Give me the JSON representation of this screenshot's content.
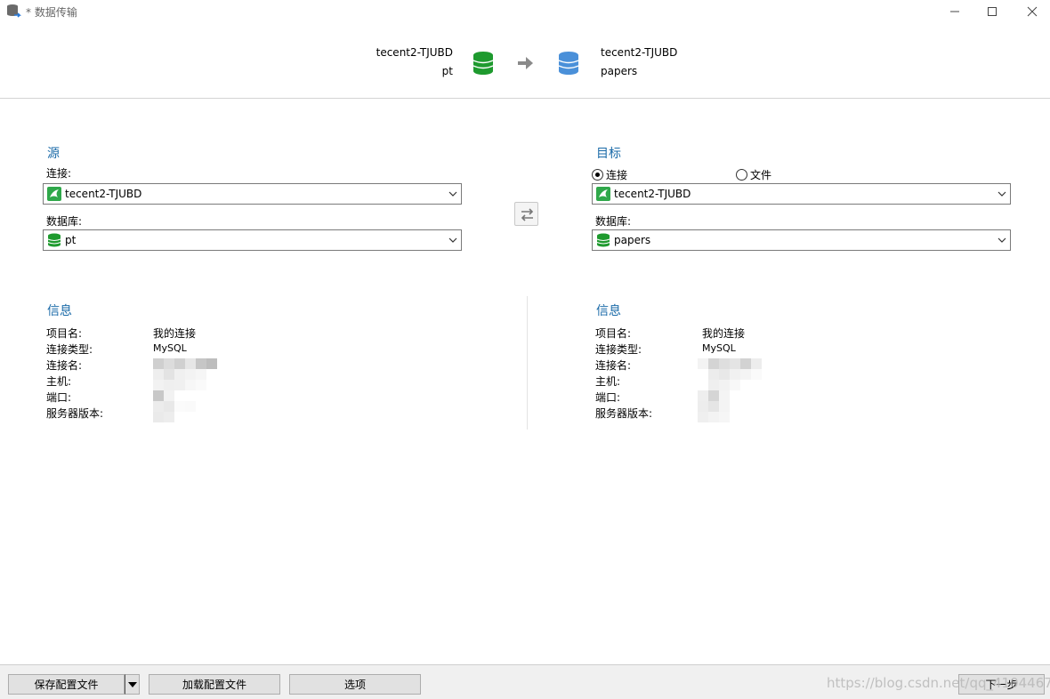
{
  "window": {
    "title": "* 数据传输",
    "minimize_glyph": "—",
    "maximize_glyph": "☐",
    "close_glyph": "✕"
  },
  "header": {
    "source_connection": "tecent2-TJUBD",
    "source_database": "pt",
    "target_connection": "tecent2-TJUBD",
    "target_database": "papers"
  },
  "source": {
    "title": "源",
    "connection_label": "连接:",
    "connection_value": "tecent2-TJUBD",
    "database_label": "数据库:",
    "database_value": "pt"
  },
  "target": {
    "title": "目标",
    "radio_connection": "连接",
    "radio_file": "文件",
    "radio_selected": "连接",
    "connection_value": "tecent2-TJUBD",
    "database_label": "数据库:",
    "database_value": "papers"
  },
  "source_info": {
    "title": "信息",
    "labels": [
      "项目名:",
      "连接类型:",
      "连接名:",
      "主机:",
      "端口:",
      "服务器版本:"
    ],
    "project_name": "我的连接",
    "connection_type": "MySQL"
  },
  "target_info": {
    "title": "信息",
    "labels": [
      "项目名:",
      "连接类型:",
      "连接名:",
      "主机:",
      "端口:",
      "服务器版本:"
    ],
    "project_name": "我的连接",
    "connection_type": "MySQL"
  },
  "footer": {
    "save_config": "保存配置文件",
    "load_config": "加载配置文件",
    "options": "选项",
    "next": "下一步",
    "watermark": "https://blog.csdn.net/qq_41044671"
  },
  "colors": {
    "accent_title": "#1a6aa8",
    "source_db_icon": "#1e9a2e",
    "target_db_icon": "#4a90d9"
  },
  "icons": {
    "app": "data-transfer-icon",
    "source_db": "database-green-icon",
    "target_db": "database-blue-icon",
    "arrow": "arrow-right-icon",
    "swap": "swap-arrows-icon",
    "connection": "mysql-connection-icon",
    "dropdown": "chevron-down-icon"
  }
}
